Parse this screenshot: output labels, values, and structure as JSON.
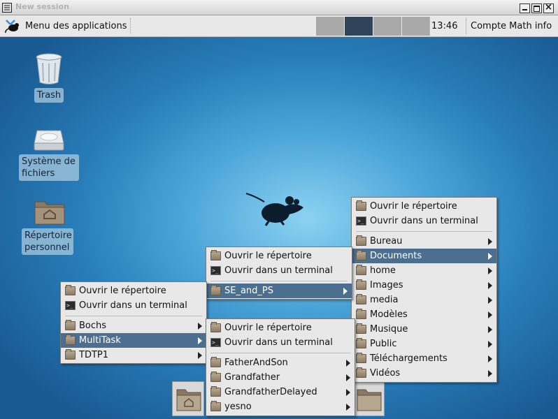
{
  "window": {
    "title": "New session"
  },
  "panel": {
    "app_menu_label": "Menu des applications",
    "workspaces": [
      "",
      "",
      "",
      ""
    ],
    "clock": "13:46",
    "user": "Compte Math info"
  },
  "desktop": {
    "icons": [
      {
        "label": "Trash"
      },
      {
        "label_line1": "Système de",
        "label_line2": "fichiers"
      },
      {
        "label_line1": "Répertoire",
        "label_line2": "personnel"
      }
    ]
  },
  "menus": {
    "home_menu": {
      "open_dir": "Ouvrir le répertoire",
      "open_term": "Ouvrir dans un terminal",
      "items": [
        "Bureau",
        "Documents",
        "home",
        "Images",
        "media",
        "Modèles",
        "Musique",
        "Public",
        "Téléchargements",
        "Vidéos"
      ]
    },
    "documents_menu": {
      "open_dir": "Ouvrir le répertoire",
      "open_term": "Ouvrir dans un terminal",
      "items": [
        "SE_and_PS"
      ]
    },
    "se_menu": {
      "open_dir": "Ouvrir le répertoire",
      "open_term": "Ouvrir dans un terminal",
      "items": [
        "Bochs",
        "MultiTask",
        "TDTP1"
      ]
    },
    "multitask_menu": {
      "open_dir": "Ouvrir le répertoire",
      "open_term": "Ouvrir dans un terminal",
      "items": [
        "FatherAndSon",
        "Grandfather",
        "GrandfatherDelayed",
        "yesno"
      ]
    }
  }
}
